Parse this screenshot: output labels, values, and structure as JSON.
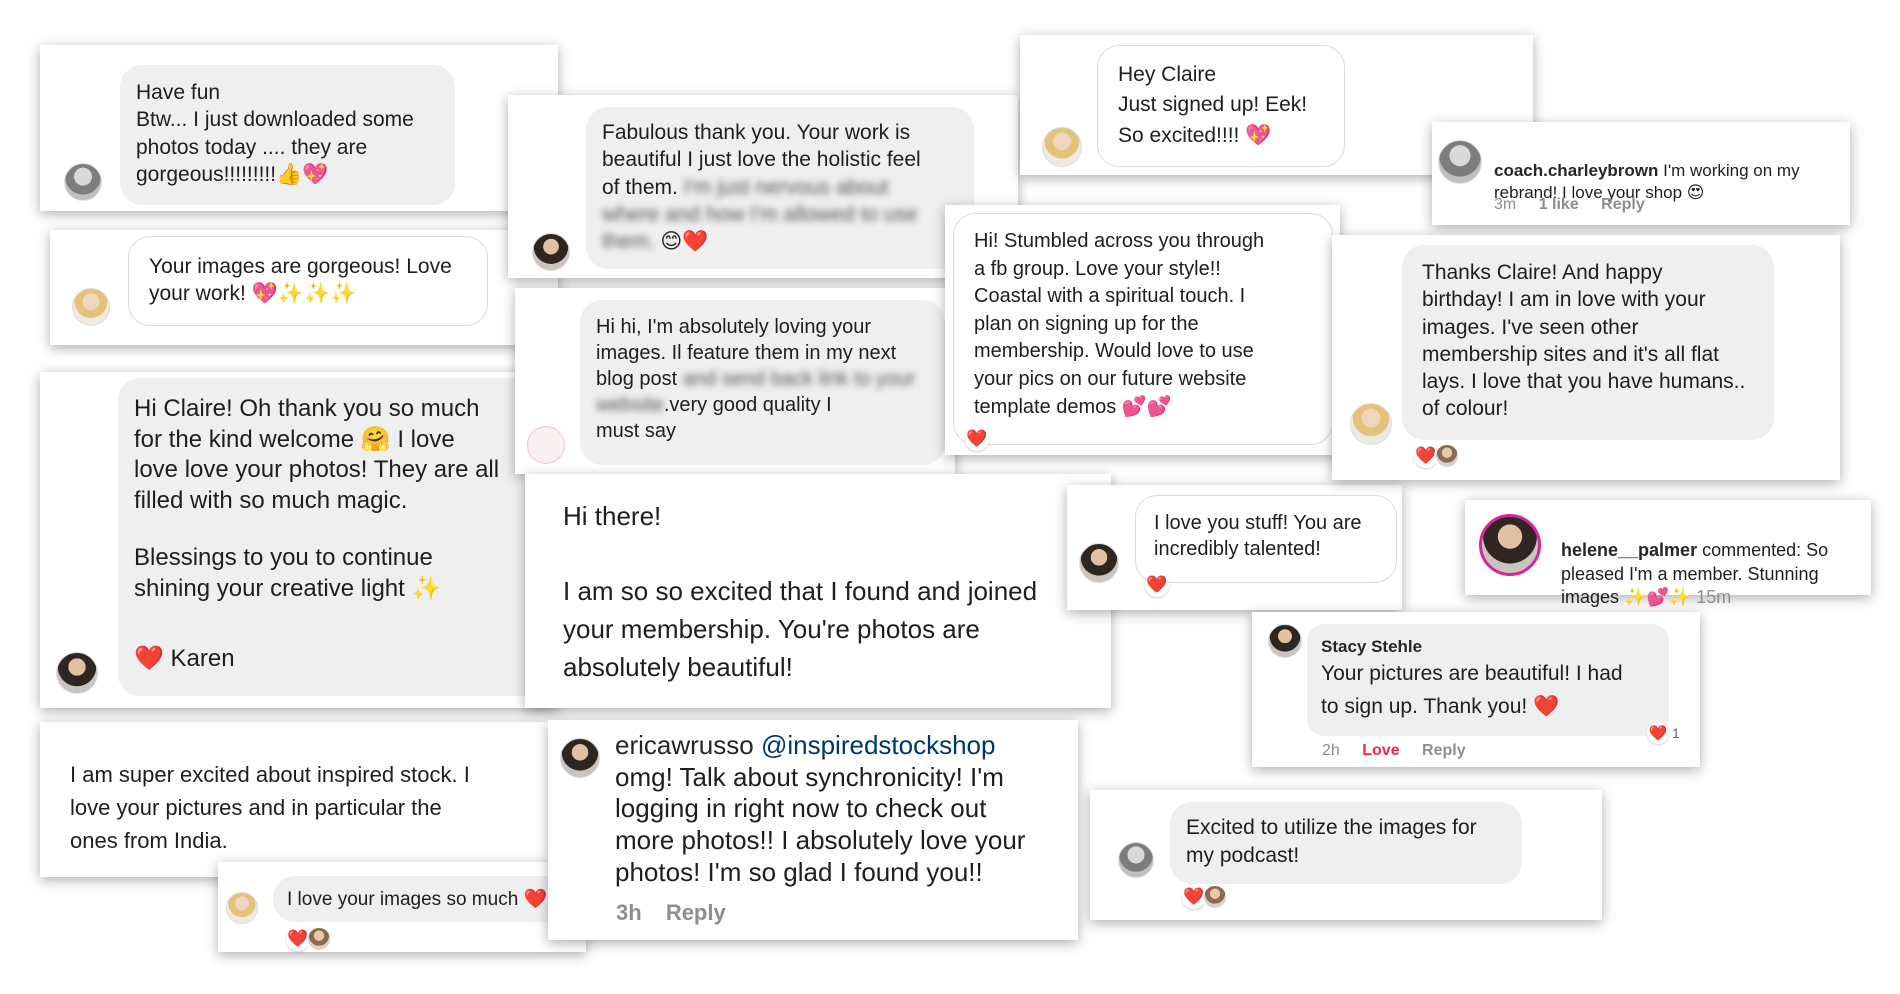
{
  "c1": {
    "lines": "Have fun\nBtw... I just downloaded some\nphotos today .... they are\ngorgeous!!!!!!!!!👍💖"
  },
  "c2": {
    "text": "Your images are gorgeous! Love\nyour work! 💖✨✨✨"
  },
  "c3": {
    "p1": "Hi Claire! Oh thank you so much\nfor the kind welcome 🤗 I love\nlove love your photos! They are all\nfilled with so much magic.",
    "p2": "Blessings to you to continue\nshining your creative light ✨",
    "p3": "❤️ Karen"
  },
  "c4": {
    "text": "I am super excited about inspired stock. I\nlove your pictures and in particular the\nones from India."
  },
  "c5": {
    "text": "I love your images so much ❤️",
    "heart": "❤️"
  },
  "c6": {
    "text": "Fabulous thank you. Your work is\nbeautiful I just love the holistic feel\nof them.",
    "blurred": "I'm just nervous about\nwhere and how I'm allowed to use\nthem.",
    "emoji": "😊❤️"
  },
  "c7": {
    "a": "Hi hi, I'm absolutely loving your\nimages. Il feature them in my next\nblog post",
    "blurred1": "and send back link to",
    "blurred2": "your website",
    "b": ".very good quality I\nmust say"
  },
  "c8": {
    "text": "Hi there!\n\nI am so so excited that I found and joined\nyour membership. You're photos are\nabsolutely beautiful!"
  },
  "c9": {
    "username": "ericawrusso",
    "mention": "@inspiredstockshop",
    "text": "omg! Talk about synchronicity! I'm\nlogging in right now to check out\nmore photos!! I absolutely love your\nphotos! I'm so glad I found you!!",
    "time": "3h",
    "reply": "Reply"
  },
  "c10": {
    "text": "Hey Claire\nJust signed up! Eek!\nSo excited!!!! 💖"
  },
  "c11": {
    "text": "Hi! Stumbled across you through\na fb group. Love your style!!\nCoastal with a spiritual touch. I\nplan on signing up for the\nmembership. Would love to use\nyour pics on our future website\ntemplate demos 💕💕",
    "heart": "❤️"
  },
  "c12": {
    "text": "I love you stuff! You are\nincredibly talented!",
    "heart": "❤️"
  },
  "c13": {
    "username": "coach.charleybrown",
    "text": "I'm working on my\nrebrand! I love your shop 😍",
    "time": "3m",
    "likes": "1 like",
    "reply": "Reply"
  },
  "c14": {
    "text": "Thanks Claire! And happy\nbirthday! I am in love with your\nimages. I've seen other\nmembership sites and it's all flat\nlays. I love that you have humans..\nof colour!",
    "heart": "❤️"
  },
  "c15": {
    "username": "helene__palmer",
    "text": "commented: So\npleased I'm a member. Stunning\nimages ✨💕✨",
    "time": "15m"
  },
  "c16": {
    "name": "Stacy Stehle",
    "text": "Your pictures are beautiful!  I had\nto sign up.  Thank you! ❤️",
    "time": "2h",
    "love": "Love",
    "reply": "Reply",
    "count": "1",
    "heart": "❤️"
  },
  "c17": {
    "text": "Excited to utilize the images for\nmy podcast!",
    "heart": "❤️"
  },
  "colors": {
    "love": "#f02849",
    "bubble": "#efefef",
    "meta": "#8e8e8e",
    "heart": "#f33e58"
  }
}
